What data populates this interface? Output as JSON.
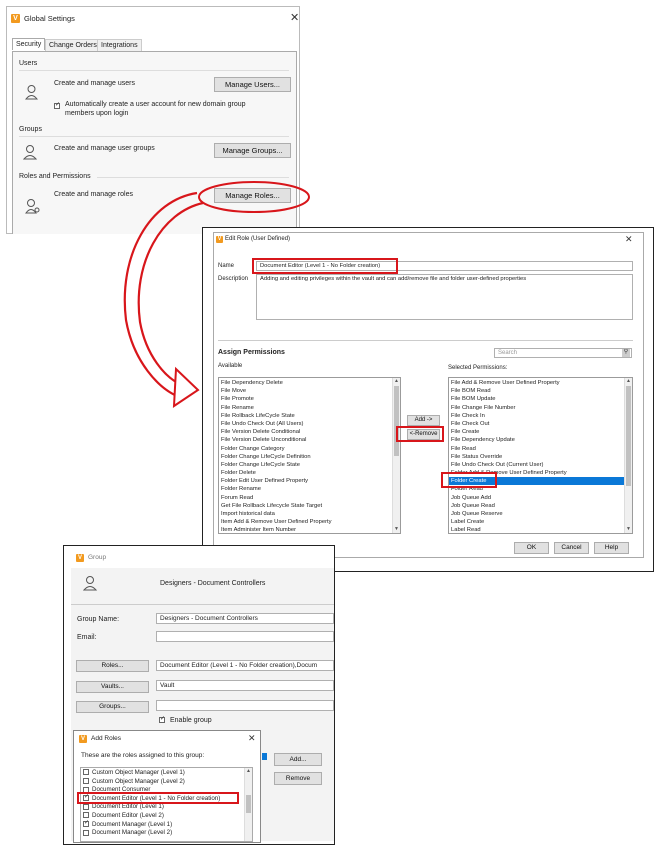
{
  "global_settings": {
    "title": "Global Settings",
    "tabs": [
      "Security",
      "Change Orders",
      "Integrations"
    ],
    "users_section": "Users",
    "users_text": "Create and manage users",
    "manage_users_btn": "Manage Users...",
    "auto_create_text_1": "Automatically create a user account for new domain group",
    "auto_create_text_2": "members upon login",
    "groups_section": "Groups",
    "groups_text": "Create and manage user groups",
    "manage_groups_btn": "Manage Groups...",
    "roles_section": "Roles and Permissions",
    "roles_text": "Create and manage roles",
    "manage_roles_btn": "Manage Roles..."
  },
  "edit_role": {
    "title": "Edit Role (User Defined)",
    "name_label": "Name",
    "name_value": "Document Editor (Level 1 - No Folder creation)",
    "description_label": "Description",
    "description_value": "Adding and editing privileges within the vault and can add/remove file and folder user-defined properties",
    "assign_permissions": "Assign Permissions",
    "search_placeholder": "Search",
    "available_label": "Available",
    "selected_label": "Selected Permissions:",
    "available": [
      "File Dependency Delete",
      "File Move",
      "File Promote",
      "File Rename",
      "File Rollback LifeCycle State",
      "File Undo Check Out (All Users)",
      "File Version Delete Conditional",
      "File Version Delete Unconditional",
      "Folder Change Category",
      "Folder Change LifeCycle Definition",
      "Folder Change LifeCycle State",
      "Folder Delete",
      "Folder Edit User Defined Property",
      "Folder Rename",
      "Forum Read",
      "Get File Rollback Lifecycle State Target",
      "Import historical data",
      "Item Add & Remove User Defined Property",
      "Item Administer Item Number"
    ],
    "selected": [
      "File Add & Remove User Defined Property",
      "File BOM Read",
      "File BOM Update",
      "File Change File Number",
      "File Check In",
      "File Check Out",
      "File Create",
      "File Dependency Update",
      "File Read",
      "File Status Override",
      "File Undo Check Out (Current User)",
      "Folder Add & Remove User Defined Property",
      "Folder Create",
      "Folder Read",
      "Job Queue Add",
      "Job Queue Read",
      "Job Queue Reserve",
      "Label Create",
      "Label Read"
    ],
    "add_btn": "Add ->",
    "remove_btn": "<-Remove",
    "ok_btn": "OK",
    "cancel_btn": "Cancel",
    "help_btn": "Help"
  },
  "group": {
    "title": "Group",
    "header_name": "Designers - Document Controllers",
    "group_name_label": "Group Name:",
    "group_name_value": "Designers - Document Controllers",
    "email_label": "Email:",
    "roles_btn": "Roles...",
    "roles_value": "Document Editor (Level 1 - No Folder creation),Docum",
    "vaults_btn": "Vaults...",
    "vaults_value": "Vault",
    "groups_btn": "Groups...",
    "enable_group": "Enable group",
    "add_btn": "Add...",
    "remove_btn": "Remove"
  },
  "add_roles": {
    "title": "Add Roles",
    "subtitle": "These are the roles assigned to this group:",
    "items": [
      {
        "label": "Custom Object Manager (Level 1)",
        "checked": false
      },
      {
        "label": "Custom Object Manager (Level 2)",
        "checked": false
      },
      {
        "label": "Document Consumer",
        "checked": false
      },
      {
        "label": "Document Editor (Level 1 - No Folder creation)",
        "checked": true
      },
      {
        "label": "Document Editor (Level 1)",
        "checked": false
      },
      {
        "label": "Document Editor (Level 2)",
        "checked": false
      },
      {
        "label": "Document Manager (Level 1)",
        "checked": true
      },
      {
        "label": "Document Manager (Level 2)",
        "checked": false
      }
    ]
  },
  "colors": {
    "highlight": "#d8161b",
    "selection": "#0a78d7",
    "vault_orange": "#f29a1f"
  }
}
